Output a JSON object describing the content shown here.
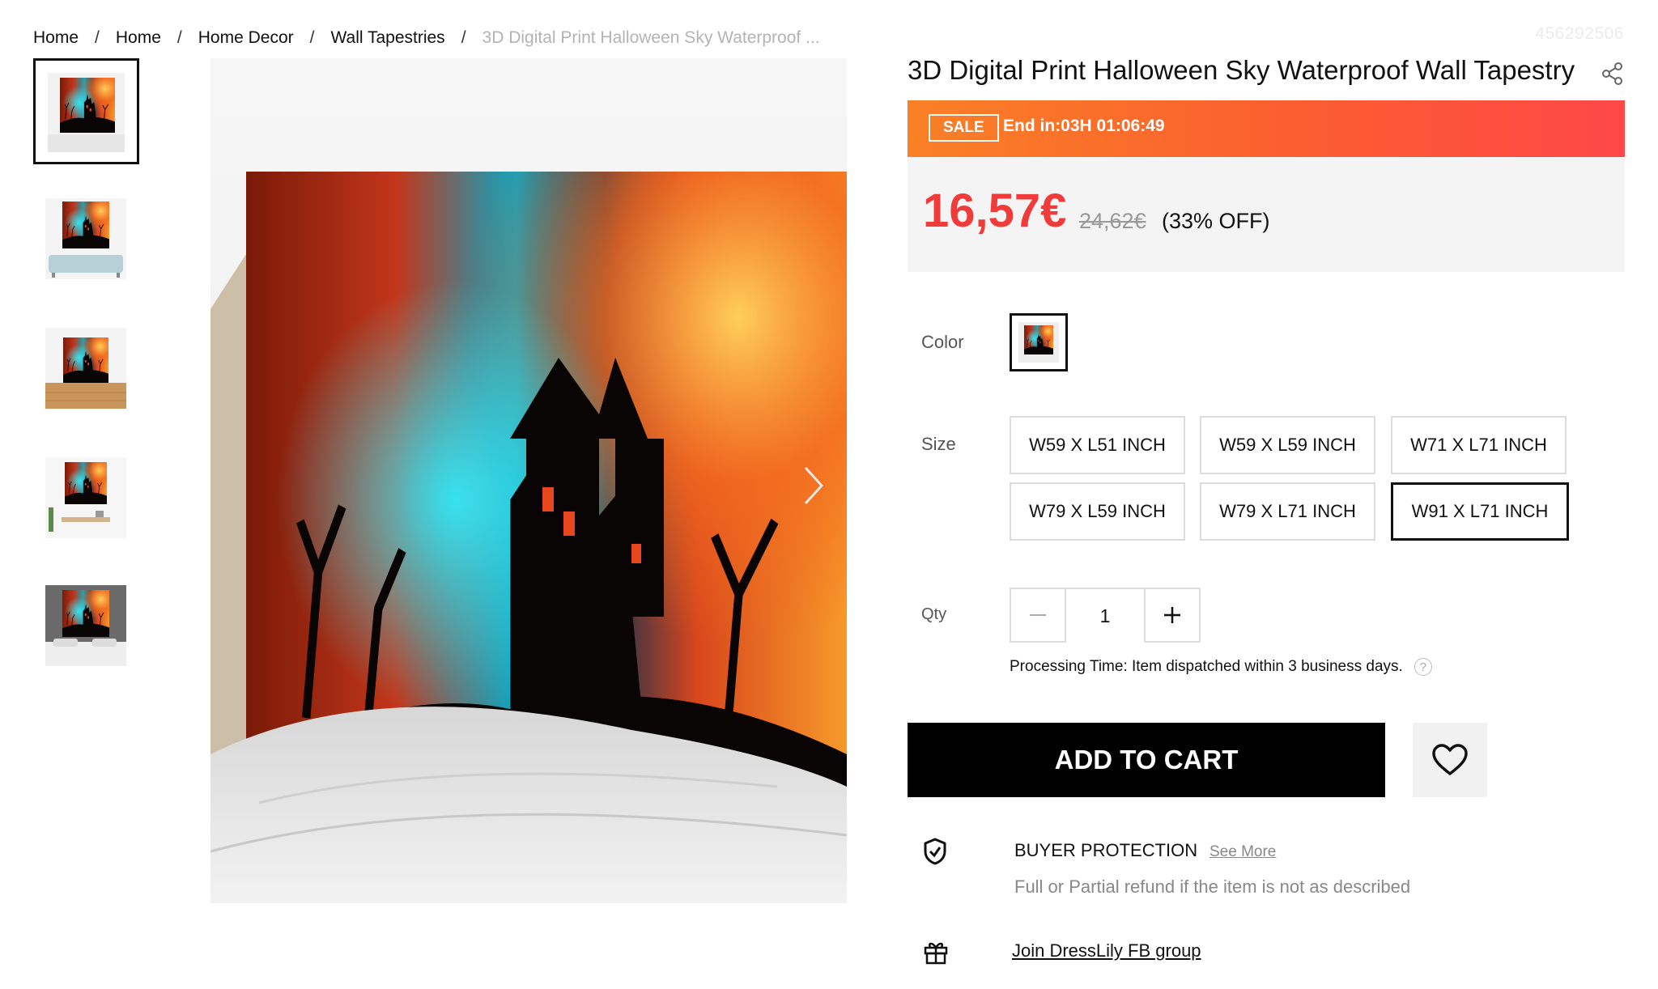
{
  "breadcrumb": {
    "items": [
      "Home",
      "Home",
      "Home Decor",
      "Wall Tapestries"
    ],
    "current": "3D Digital Print Halloween Sky Waterproof ...",
    "separator": "/"
  },
  "sku": "456292506",
  "product": {
    "title": "3D Digital Print Halloween Sky Waterproof Wall Tapestry"
  },
  "sale": {
    "badge": "SALE",
    "countdown": "End in:03H 01:06:49"
  },
  "price": {
    "current": "16,57€",
    "original": "24,62€",
    "discount": "(33% OFF)"
  },
  "options": {
    "color_label": "Color",
    "size_label": "Size",
    "qty_label": "Qty",
    "sizes": [
      "W59 X L51 INCH",
      "W59 X L59 INCH",
      "W71 X L71 INCH",
      "W79 X L59 INCH",
      "W79 X L71 INCH",
      "W91 X L71 INCH"
    ],
    "selected_size": "W91 X L71 INCH",
    "quantity": "1"
  },
  "processing_text": "Processing Time: Item dispatched within 3 business days.",
  "actions": {
    "add_to_cart": "ADD TO CART"
  },
  "protection": {
    "title": "BUYER PROTECTION",
    "see_more": "See More",
    "description": "Full or Partial refund if the item is not as described"
  },
  "fb_group": "Join DressLily FB group",
  "icons": [
    "share-icon",
    "chevron-right-icon",
    "minus-icon",
    "plus-icon",
    "help-icon",
    "heart-icon",
    "shield-check-icon",
    "gift-icon"
  ],
  "colors": {
    "accent_red": "#f03b3b",
    "sale_gradient_start": "#f98025",
    "sale_gradient_end": "#fe4848",
    "button_black": "#000000"
  }
}
